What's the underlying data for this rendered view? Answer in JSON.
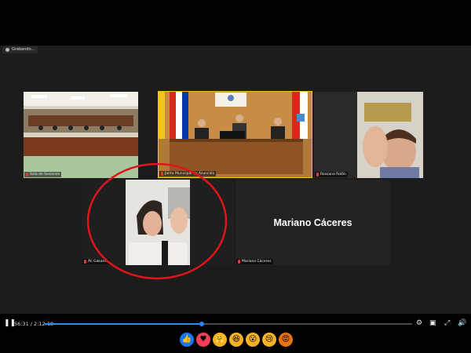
{
  "recording": {
    "label": "Grabando..."
  },
  "participants": [
    {
      "name": "Sala de Sesiones"
    },
    {
      "name": "Junta Municipal de Asunción"
    },
    {
      "name": "Rossana Rolón"
    },
    {
      "name": "Ali Gakante"
    },
    {
      "name": "Mariano Cáceres",
      "display_text": "Mariano Cáceres"
    }
  ],
  "player": {
    "time": "56:31 / 2:12:18",
    "progress": 0.427,
    "accent": "#2d88ff"
  },
  "annotation": {
    "shape": "ellipse",
    "color": "#e0141a"
  },
  "reactions": [
    {
      "name": "like-icon",
      "glyph": "👍",
      "color": "#1877f2"
    },
    {
      "name": "love-icon",
      "glyph": "♥",
      "color": "#f33e58"
    },
    {
      "name": "care-icon",
      "glyph": "🤗",
      "color": "#f7b125"
    },
    {
      "name": "haha-icon",
      "glyph": "😆",
      "color": "#f7b125"
    },
    {
      "name": "wow-icon",
      "glyph": "😮",
      "color": "#f7b125"
    },
    {
      "name": "sad-icon",
      "glyph": "😢",
      "color": "#f7b125"
    },
    {
      "name": "angry-icon",
      "glyph": "😡",
      "color": "#e9710f"
    }
  ]
}
